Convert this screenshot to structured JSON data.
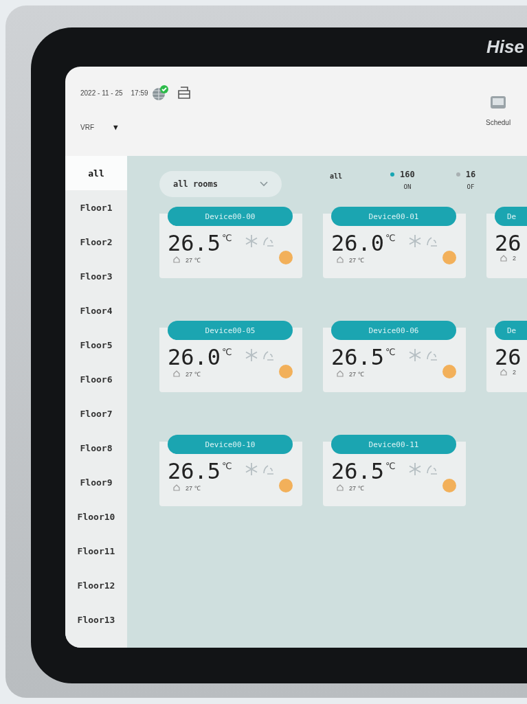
{
  "brand": "Hise",
  "header": {
    "date": "2022 - 11 - 25",
    "time": "17:59",
    "network_connected": true,
    "system": "VRF",
    "dropdown_caret": "▼",
    "nav_label": "Schedul"
  },
  "sidebar": {
    "items": [
      {
        "label": "all",
        "selected": true
      },
      {
        "label": "Floor1",
        "selected": false
      },
      {
        "label": "Floor2",
        "selected": false
      },
      {
        "label": "Floor3",
        "selected": false
      },
      {
        "label": "Floor4",
        "selected": false
      },
      {
        "label": "Floor5",
        "selected": false
      },
      {
        "label": "Floor6",
        "selected": false
      },
      {
        "label": "Floor7",
        "selected": false
      },
      {
        "label": "Floor8",
        "selected": false
      },
      {
        "label": "Floor9",
        "selected": false
      },
      {
        "label": "Floor10",
        "selected": false
      },
      {
        "label": "Floor11",
        "selected": false
      },
      {
        "label": "Floor12",
        "selected": false
      },
      {
        "label": "Floor13",
        "selected": false
      }
    ]
  },
  "filter": {
    "room_select": "all rooms",
    "all_label": "all",
    "counts": [
      {
        "value": "160",
        "label": "ON",
        "color": "#18a6b3"
      },
      {
        "value": "16",
        "label": "OF",
        "color": "#a9b1b3"
      }
    ]
  },
  "devices": [
    {
      "name": "Device00-00",
      "temp": "26.5",
      "unit": "℃",
      "room_temp": "27 ℃"
    },
    {
      "name": "Device00-01",
      "temp": "26.0",
      "unit": "℃",
      "room_temp": "27 ℃"
    },
    {
      "name": "De",
      "temp": "26",
      "room_temp": "2"
    },
    {
      "name": "Device00-05",
      "temp": "26.0",
      "unit": "℃",
      "room_temp": "27 ℃"
    },
    {
      "name": "Device00-06",
      "temp": "26.5",
      "unit": "℃",
      "room_temp": "27 ℃"
    },
    {
      "name": "De",
      "temp": "26",
      "room_temp": "2"
    },
    {
      "name": "Device00-10",
      "temp": "26.5",
      "unit": "℃",
      "room_temp": "27 ℃"
    },
    {
      "name": "Device00-11",
      "temp": "26.5",
      "unit": "℃",
      "room_temp": "27 ℃"
    }
  ]
}
